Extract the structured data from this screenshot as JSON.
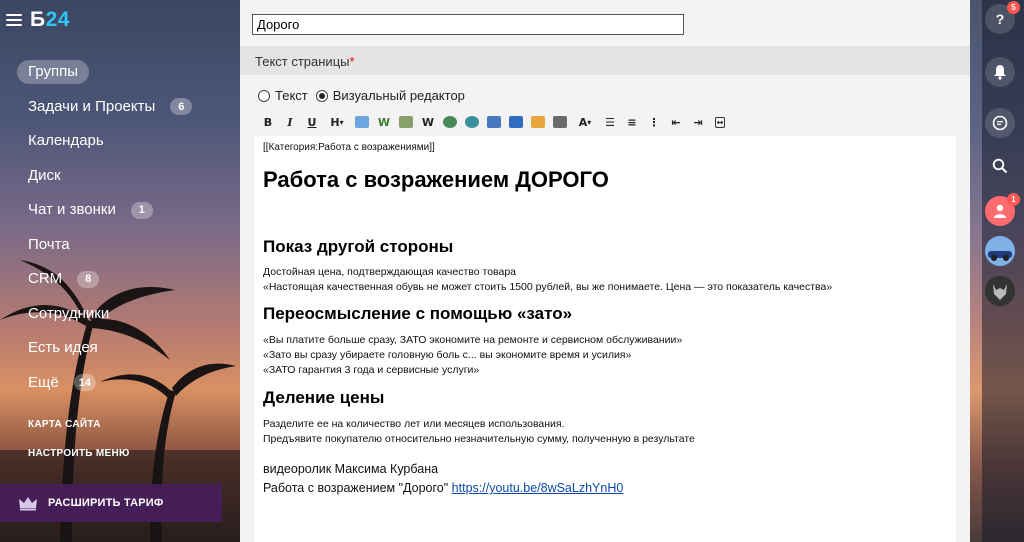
{
  "sidebar": {
    "logo_left": "Б",
    "logo_right": "24",
    "items": [
      {
        "label": "Группы",
        "counter": ""
      },
      {
        "label": "Задачи и Проекты",
        "counter": "6"
      },
      {
        "label": "Календарь",
        "counter": ""
      },
      {
        "label": "Диск",
        "counter": ""
      },
      {
        "label": "Чат и звонки",
        "counter": "1"
      },
      {
        "label": "Почта",
        "counter": ""
      },
      {
        "label": "CRM",
        "counter": "8"
      },
      {
        "label": "Сотрудники",
        "counter": ""
      },
      {
        "label": "Есть идея",
        "counter": ""
      },
      {
        "label": "Ещё",
        "counter": "14"
      }
    ],
    "sitemap": "КАРТА САЙТА",
    "configure_menu": "НАСТРОИТЬ МЕНЮ",
    "upgrade_plan": "РАСШИРИТЬ ТАРИФ"
  },
  "form": {
    "title_value": "Дорого",
    "page_text_label": "Текст страницы",
    "required_mark": "*",
    "mode_text": "Текст",
    "mode_visual": "Визуальный редактор"
  },
  "toolbar": {
    "bold": "B",
    "italic": "I",
    "underline": "U",
    "heading": "H",
    "wiki": "W",
    "sub": "W",
    "text_size": "A"
  },
  "editor": {
    "category": "[[Категория:Работа с возражениями]]",
    "h1": "Работа с возражением ДОРОГО",
    "s1_title": "Показ другой стороны",
    "s1_line1": "Достойная цена, подтверждающая качество товара",
    "s1_line2": "«Настоящая качественная обувь не может стоить 1500 рублей, вы же понимаете. Цена — это показатель качества»",
    "s2_title": "Переосмысление с помощью «зато»",
    "s2_line1": "«Вы платите больше сразу, ЗАТО экономите на ремонте и сервисном обслуживании»",
    "s2_line2": "«Зато вы сразу убираете головную боль с... вы экономите время и усилия»",
    "s2_line3": "«ЗАТО гарантия 3 года и сервисные услуги»",
    "s3_title": "Деление цены",
    "s3_line1": "Разделите ее на количество лет или месяцев использования.",
    "s3_line2": "Предъявите покупателю относительно незначительную сумму, полученную в результате",
    "video_label": "видеоролик Максима Курбана",
    "video_text": "Работа с возражением \"Дорого\"",
    "video_url": "https://youtu.be/8wSaLzhYnH0"
  },
  "rightbar": {
    "help_badge": "5",
    "user_badge": "1"
  },
  "colors": {
    "accent": "#2fc6f6",
    "badge": "#ff5752",
    "link": "#0b4aa8"
  }
}
